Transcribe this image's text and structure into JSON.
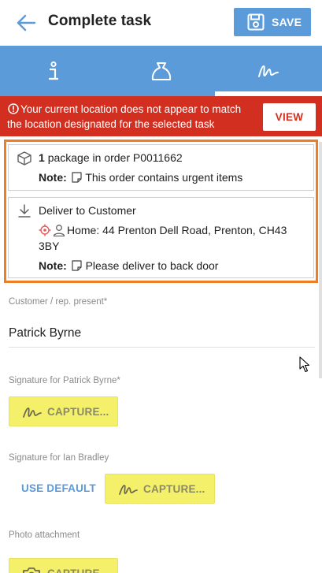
{
  "header": {
    "title": "Complete task",
    "save_label": "SAVE"
  },
  "tabs": [
    {
      "icon": "info-icon"
    },
    {
      "icon": "bag-icon"
    },
    {
      "icon": "signature-icon",
      "selected": true
    }
  ],
  "alert": {
    "message": "Your current location does not appear to match the location designated for the selected task",
    "view_label": "VIEW",
    "color": "#d32f20"
  },
  "order": {
    "count": "1",
    "package_text": "package in order P0011662",
    "note_label": "Note:",
    "note_text": "This order contains urgent items"
  },
  "delivery": {
    "title": "Deliver to Customer",
    "address": "Home: 44 Prenton Dell Road, Prenton, CH43",
    "address_line2": "3BY",
    "note_label": "Note:",
    "note_text": "Please deliver to back door"
  },
  "form": {
    "customer_label": "Customer / rep. present*",
    "customer_value": "Patrick Byrne",
    "sig1_label": "Signature for Patrick Byrne*",
    "sig2_label": "Signature for Ian Bradley",
    "use_default_label": "USE DEFAULT",
    "capture_label": "CAPTURE...",
    "photo_label": "Photo attachment"
  },
  "colors": {
    "accent": "#5b9bd9",
    "highlight": "#ef7d22",
    "capture_bg": "#f5f06a"
  }
}
